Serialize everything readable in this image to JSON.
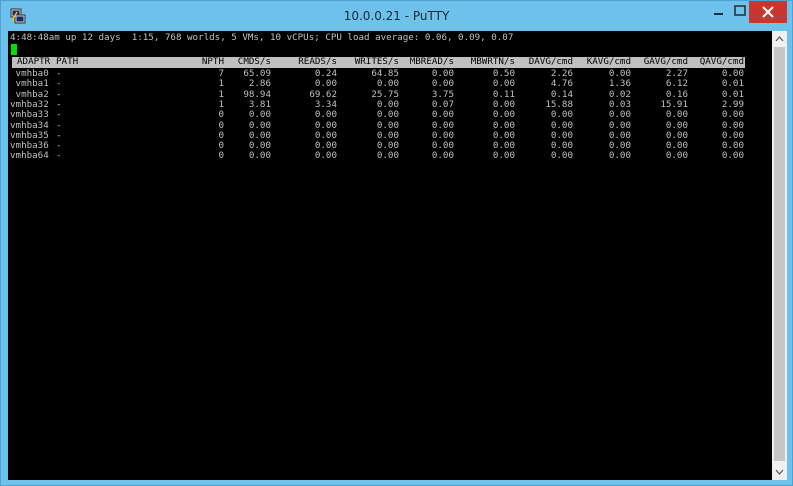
{
  "window": {
    "title": "10.0.0.21 - PuTTY",
    "icon": "putty-icon",
    "accent": "#6ec1ea",
    "close_color": "#c7372f"
  },
  "terminal": {
    "status_line": "4:48:48am up 12 days  1:15, 768 worlds, 5 VMs, 10 vCPUs; CPU load average: 0.06, 0.09, 0.07",
    "cursor_color": "#00e000",
    "columns": [
      "ADAPTR",
      "PATH",
      "NPTH",
      "CMDS/s",
      "READS/s",
      "WRITES/s",
      "MBREAD/s",
      "MBWRTN/s",
      "DAVG/cmd",
      "KAVG/cmd",
      "GAVG/cmd",
      "QAVG/cmd"
    ],
    "rows": [
      {
        "adapter": " vmhba0",
        "path": "-",
        "npth": "7",
        "cmds": "65.09",
        "reads": "0.24",
        "writes": "64.85",
        "mbread": "0.00",
        "mbwrtn": "0.50",
        "davg": "2.26",
        "kavg": "0.00",
        "gavg": "2.27",
        "qavg": "0.00"
      },
      {
        "adapter": " vmhba1",
        "path": "-",
        "npth": "1",
        "cmds": "2.86",
        "reads": "0.00",
        "writes": "0.00",
        "mbread": "0.00",
        "mbwrtn": "0.00",
        "davg": "4.76",
        "kavg": "1.36",
        "gavg": "6.12",
        "qavg": "0.01"
      },
      {
        "adapter": " vmhba2",
        "path": "-",
        "npth": "1",
        "cmds": "98.94",
        "reads": "69.62",
        "writes": "25.75",
        "mbread": "3.75",
        "mbwrtn": "0.11",
        "davg": "0.14",
        "kavg": "0.02",
        "gavg": "0.16",
        "qavg": "0.01"
      },
      {
        "adapter": "vmhba32",
        "path": "-",
        "npth": "1",
        "cmds": "3.81",
        "reads": "3.34",
        "writes": "0.00",
        "mbread": "0.07",
        "mbwrtn": "0.00",
        "davg": "15.88",
        "kavg": "0.03",
        "gavg": "15.91",
        "qavg": "2.99"
      },
      {
        "adapter": "vmhba33",
        "path": "-",
        "npth": "0",
        "cmds": "0.00",
        "reads": "0.00",
        "writes": "0.00",
        "mbread": "0.00",
        "mbwrtn": "0.00",
        "davg": "0.00",
        "kavg": "0.00",
        "gavg": "0.00",
        "qavg": "0.00"
      },
      {
        "adapter": "vmhba34",
        "path": "-",
        "npth": "0",
        "cmds": "0.00",
        "reads": "0.00",
        "writes": "0.00",
        "mbread": "0.00",
        "mbwrtn": "0.00",
        "davg": "0.00",
        "kavg": "0.00",
        "gavg": "0.00",
        "qavg": "0.00"
      },
      {
        "adapter": "vmhba35",
        "path": "-",
        "npth": "0",
        "cmds": "0.00",
        "reads": "0.00",
        "writes": "0.00",
        "mbread": "0.00",
        "mbwrtn": "0.00",
        "davg": "0.00",
        "kavg": "0.00",
        "gavg": "0.00",
        "qavg": "0.00"
      },
      {
        "adapter": "vmhba36",
        "path": "-",
        "npth": "0",
        "cmds": "0.00",
        "reads": "0.00",
        "writes": "0.00",
        "mbread": "0.00",
        "mbwrtn": "0.00",
        "davg": "0.00",
        "kavg": "0.00",
        "gavg": "0.00",
        "qavg": "0.00"
      },
      {
        "adapter": "vmhba64",
        "path": "-",
        "npth": "0",
        "cmds": "0.00",
        "reads": "0.00",
        "writes": "0.00",
        "mbread": "0.00",
        "mbwrtn": "0.00",
        "davg": "0.00",
        "kavg": "0.00",
        "gavg": "0.00",
        "qavg": "0.00"
      }
    ]
  },
  "controls": {
    "minimize_icon": "minimize-icon",
    "maximize_icon": "maximize-icon",
    "close_icon": "close-icon",
    "scroll_up_icon": "chevron-up-icon",
    "scroll_down_icon": "chevron-down-icon"
  }
}
